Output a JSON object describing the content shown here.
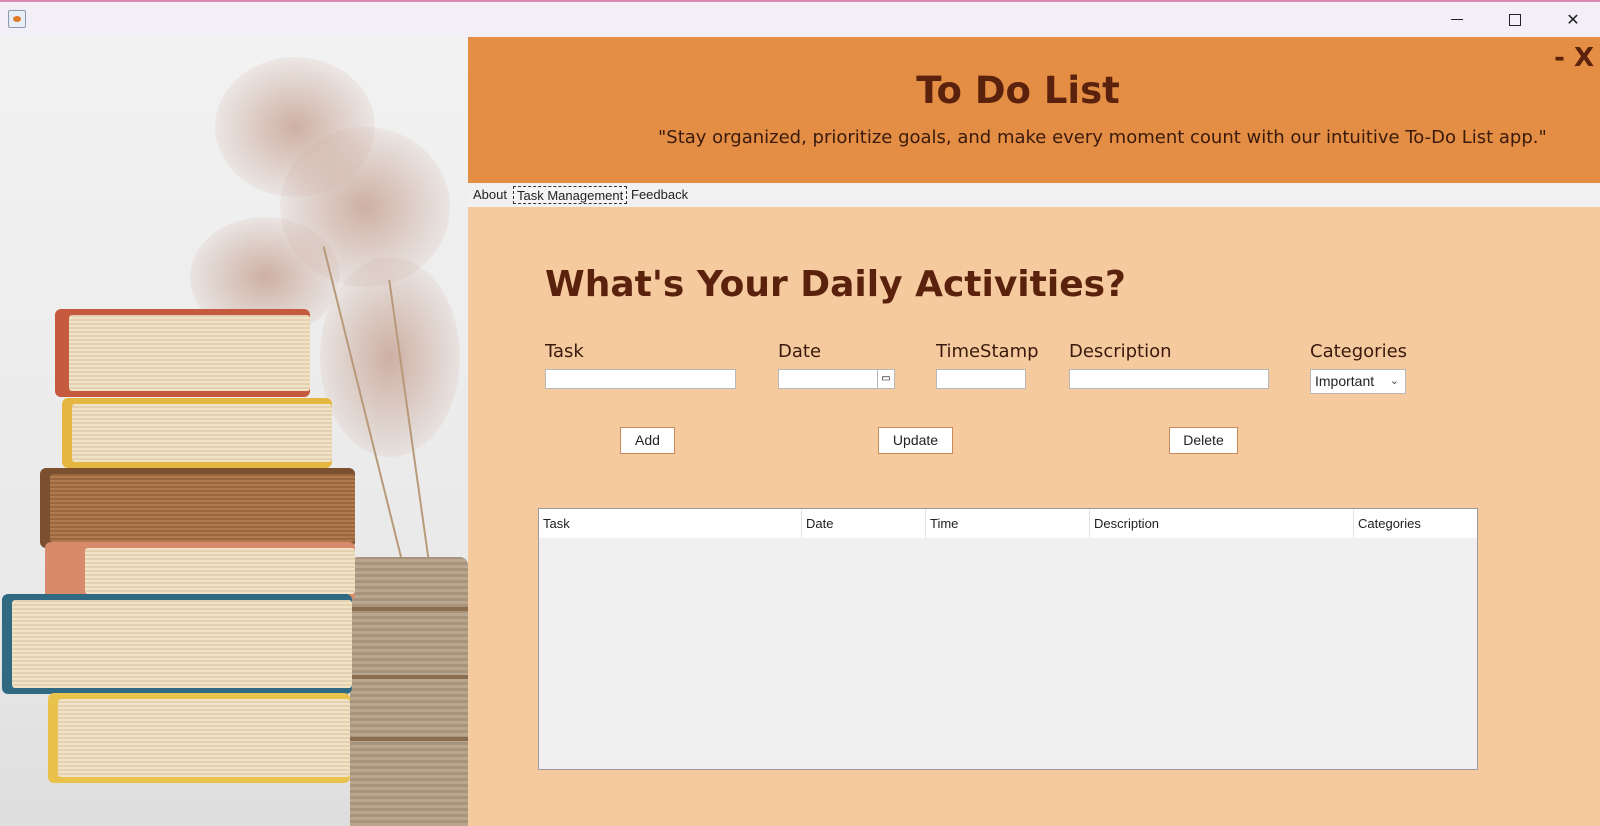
{
  "header": {
    "title": "To Do List",
    "tagline": "\"Stay organized, prioritize goals, and make every moment count with our intuitive To-Do List app.\"",
    "min_close": "- X"
  },
  "tabs": [
    {
      "label": "About",
      "active": false
    },
    {
      "label": "Task Management",
      "active": true
    },
    {
      "label": "Feedback",
      "active": false
    }
  ],
  "form": {
    "heading": "What's Your Daily Activities?",
    "labels": {
      "task": "Task",
      "date": "Date",
      "timestamp": "TimeStamp",
      "description": "Description",
      "categories": "Categories"
    },
    "values": {
      "task": "",
      "date": "",
      "timestamp": "",
      "description": ""
    },
    "category_selected": "Important",
    "buttons": {
      "add": "Add",
      "update": "Update",
      "delete": "Delete"
    }
  },
  "table": {
    "columns": [
      "Task",
      "Date",
      "Time",
      "Description",
      "Categories"
    ],
    "rows": []
  },
  "colors": {
    "header_bg": "#e38e44",
    "content_bg": "#f5ca9e",
    "heading_text": "#5a210c"
  }
}
